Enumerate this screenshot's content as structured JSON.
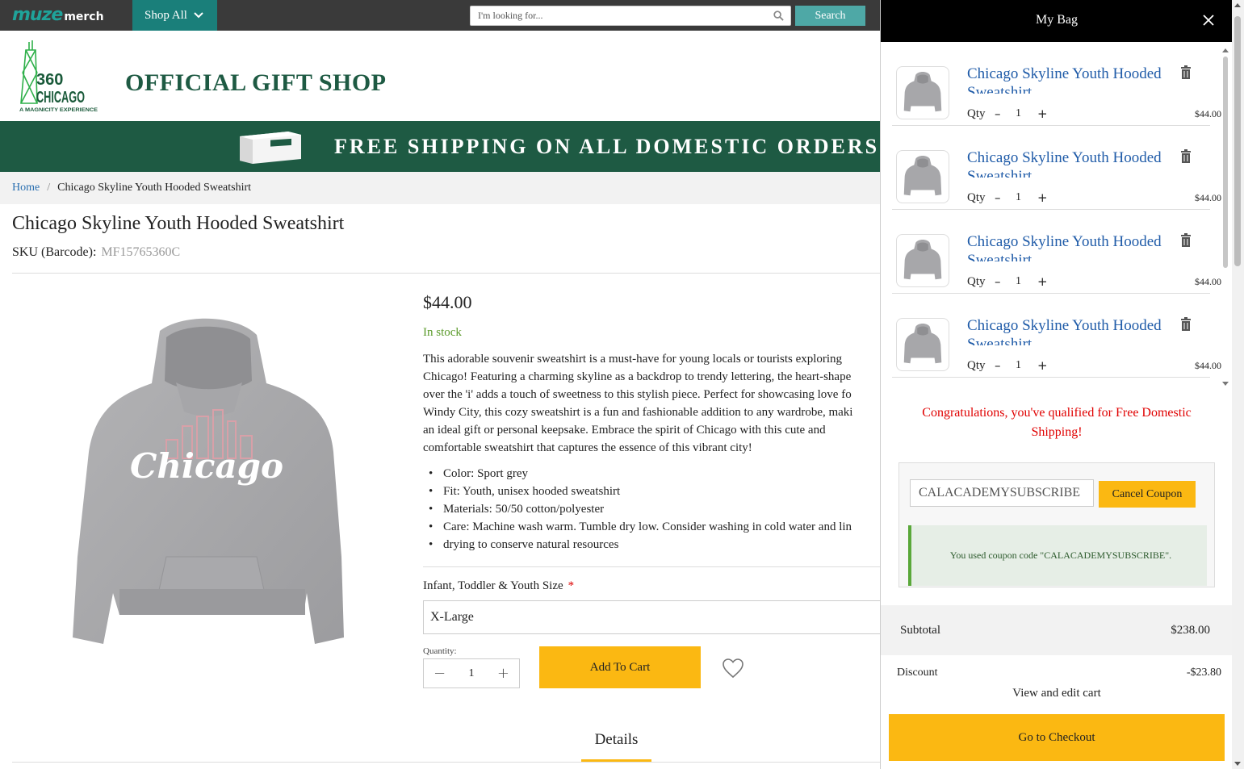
{
  "topbar": {
    "brand_main": "muze",
    "brand_sub": "merch",
    "shop_all": "Shop All",
    "search_placeholder": "I'm looking for...",
    "search_button": "Search"
  },
  "header": {
    "logo_line1": "360",
    "logo_line2": "CHICAGO",
    "logo_tagline": "A MAGNICITY EXPERIENCE",
    "title": "OFFICIAL GIFT SHOP"
  },
  "promo": {
    "text": "FREE SHIPPING ON ALL DOMESTIC ORDERS"
  },
  "breadcrumb": {
    "home": "Home",
    "separator": "/",
    "current": "Chicago Skyline Youth Hooded Sweatshirt"
  },
  "product": {
    "title": "Chicago Skyline Youth Hooded Sweatshirt",
    "sku_label": "SKU (Barcode):",
    "sku": "MF15765360C",
    "price": "$44.00",
    "stock": "In stock",
    "description_lines": [
      "This adorable souvenir sweatshirt is a must-have for young locals or tourists exploring",
      "Chicago! Featuring a charming skyline as a backdrop to trendy lettering, the heart-shape",
      "over the 'i' adds a touch of sweetness to this stylish piece. Perfect for showcasing love fo",
      "Windy City, this cozy sweatshirt is a fun and fashionable addition to any wardrobe, maki",
      "an ideal gift or personal keepsake. Embrace the spirit of Chicago with this cute and",
      "comfortable sweatshirt that captures the essence of this vibrant city!"
    ],
    "bullets": [
      "Color: Sport grey",
      "Fit: Youth, unisex hooded sweatshirt",
      "Materials: 50/50 cotton/polyester",
      "Care: Machine wash warm. Tumble dry low. Consider washing in cold water and lin",
      "drying to conserve natural resources"
    ],
    "size_label": "Infant, Toddler & Youth Size",
    "required_mark": "*",
    "size_value": "X-Large",
    "qty_label": "Quantity:",
    "qty_value": "1",
    "minus": "−",
    "plus": "+",
    "add_to_cart": "Add To Cart",
    "details_tab": "Details",
    "image_lettering": "Chicago"
  },
  "bag": {
    "title": "My Bag",
    "items": [
      {
        "name": "Chicago Skyline Youth Hooded",
        "name_cont": "Sweatshirt",
        "qty_label": "Qty",
        "minus": "–",
        "qty": "1",
        "plus": "+",
        "price": "$44.00"
      },
      {
        "name": "Chicago Skyline Youth Hooded",
        "name_cont": "Sweatshirt",
        "qty_label": "Qty",
        "minus": "–",
        "qty": "1",
        "plus": "+",
        "price": "$44.00"
      },
      {
        "name": "Chicago Skyline Youth Hooded",
        "name_cont": "Sweatshirt",
        "qty_label": "Qty",
        "minus": "–",
        "qty": "1",
        "plus": "+",
        "price": "$44.00"
      },
      {
        "name": "Chicago Skyline Youth Hooded",
        "name_cont": "Sweatshirt",
        "qty_label": "Qty",
        "minus": "–",
        "qty": "1",
        "plus": "+",
        "price": "$44.00"
      }
    ],
    "congrats": "Congratulations, you've qualified for Free Domestic Shipping!",
    "coupon_code": "CALACADEMYSUBSCRIBE",
    "cancel_coupon": "Cancel Coupon",
    "coupon_message": "You used coupon code \"CALACADEMYSUBSCRIBE\".",
    "subtotal_label": "Subtotal",
    "subtotal_value": "$238.00",
    "discount_label": "Discount",
    "discount_value": "-$23.80",
    "view_cart": "View and edit cart",
    "checkout": "Go to Checkout"
  },
  "colors": {
    "brand_green": "#1e5a43",
    "teal": "#1a7f7a",
    "accent_yellow": "#fbb812",
    "link_blue": "#1f5ba8",
    "alert_red": "#e00000",
    "stock_green": "#5a9a2a"
  }
}
